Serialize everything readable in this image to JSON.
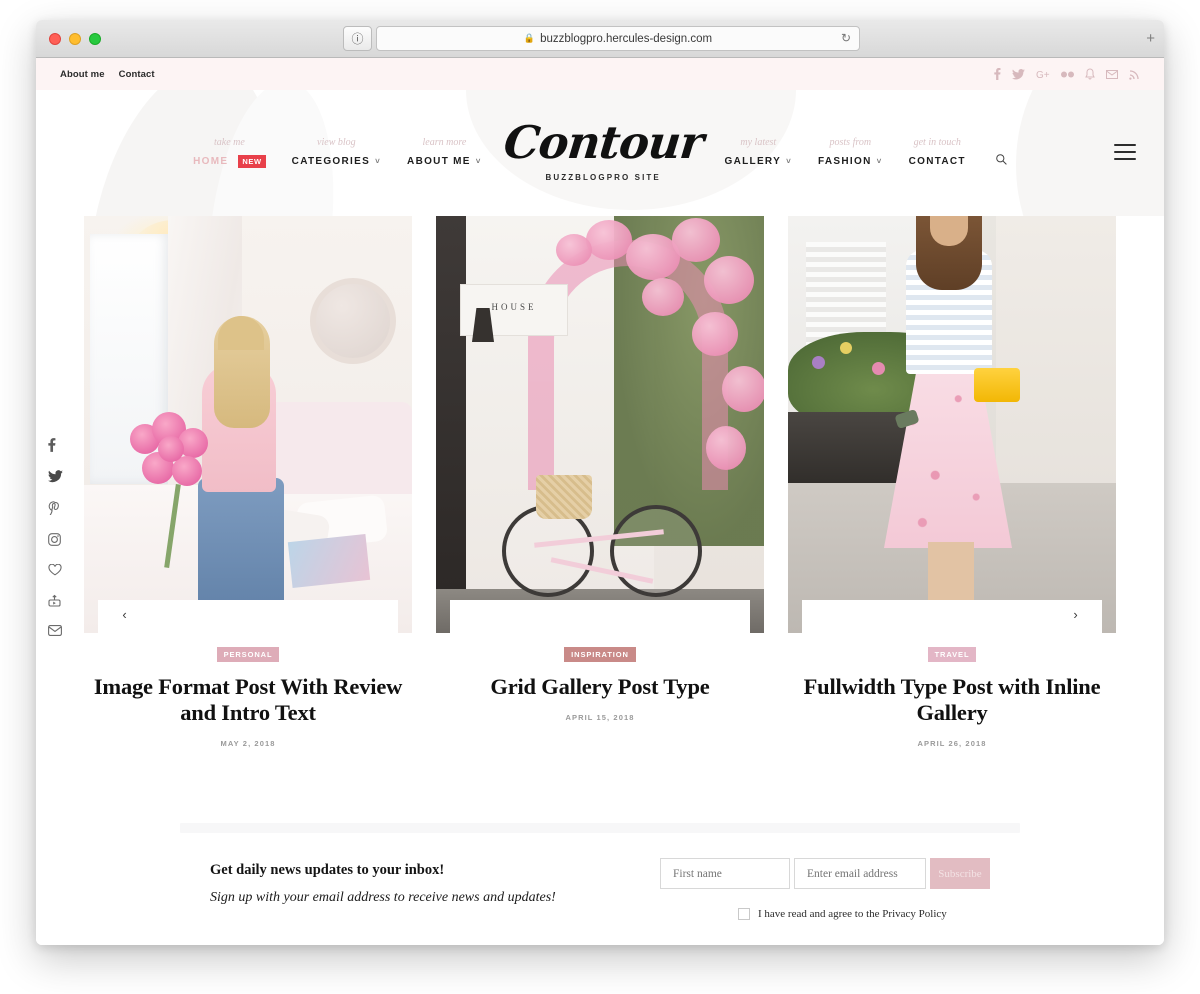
{
  "browser": {
    "url": "buzzblogpro.hercules-design.com",
    "lock_icon": "lock-icon",
    "reload_icon": "reload-icon",
    "shield_icon": "shield-icon",
    "newtab_icon": "plus-icon"
  },
  "topbar": {
    "links": [
      {
        "label": "About me"
      },
      {
        "label": "Contact"
      }
    ],
    "social": [
      {
        "name": "facebook-icon",
        "glyph": "f"
      },
      {
        "name": "twitter-icon",
        "glyph": "t"
      },
      {
        "name": "google-plus-icon",
        "glyph": "G+"
      },
      {
        "name": "flickr-icon",
        "glyph": "dots"
      },
      {
        "name": "bell-icon",
        "glyph": "bell"
      },
      {
        "name": "envelope-icon",
        "glyph": "mail"
      },
      {
        "name": "rss-icon",
        "glyph": "rss"
      }
    ]
  },
  "header": {
    "logo": "Contour",
    "tagline": "BUZZBLOGPRO SITE",
    "search_icon": "search-icon",
    "menu_icon": "hamburger-icon",
    "nav_left": [
      {
        "sub": "take me",
        "label": "HOME",
        "badge": "NEW",
        "caret": "",
        "active": true
      },
      {
        "sub": "view blog",
        "label": "CATEGORIES",
        "badge": "",
        "caret": "˅",
        "active": false
      },
      {
        "sub": "learn more",
        "label": "ABOUT ME",
        "badge": "",
        "caret": "˅",
        "active": false
      }
    ],
    "nav_right": [
      {
        "sub": "my latest",
        "label": "GALLERY",
        "badge": "",
        "caret": "˅",
        "active": false
      },
      {
        "sub": "posts from",
        "label": "FASHION",
        "badge": "",
        "caret": "˅",
        "active": false
      },
      {
        "sub": "get in touch",
        "label": "CONTACT",
        "badge": "",
        "caret": "",
        "active": false
      }
    ]
  },
  "social_rail": [
    {
      "name": "facebook-icon"
    },
    {
      "name": "twitter-icon"
    },
    {
      "name": "pinterest-icon"
    },
    {
      "name": "instagram-icon"
    },
    {
      "name": "bloglovin-heart-icon"
    },
    {
      "name": "youtube-icon"
    },
    {
      "name": "email-icon"
    }
  ],
  "slider": {
    "prev_label": "‹",
    "next_label": "›",
    "posts": [
      {
        "category": "PERSONAL",
        "category_color": "#deacb8",
        "title": "Image Format Post With Review and Intro Text",
        "date": "MAY 2, 2018"
      },
      {
        "category": "INSPIRATION",
        "category_color": "#c98a88",
        "title": "Grid Gallery Post Type",
        "date": "APRIL 15, 2018"
      },
      {
        "category": "TRAVEL",
        "category_color": "#e3b6c6",
        "title": "Fullwidth Type Post with Inline Gallery",
        "date": "APRIL 26, 2018"
      }
    ]
  },
  "newsletter": {
    "heading": "Get daily news updates to your inbox!",
    "subheading": "Sign up with your email address to receive news and updates!",
    "first_name_placeholder": "First name",
    "email_placeholder": "Enter email address",
    "subscribe_label": "Subscribe",
    "consent_label": "I have read and agree to the Privacy Policy",
    "accent_color": "#e2bcc2"
  }
}
